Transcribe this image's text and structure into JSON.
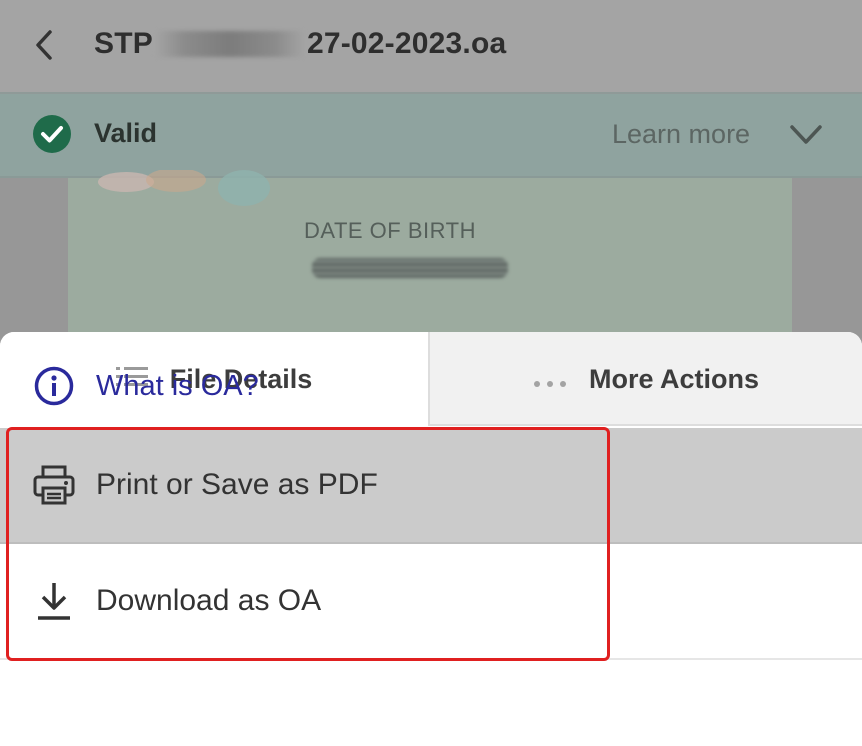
{
  "header": {
    "title_prefix": "STP",
    "title_suffix": "27-02-2023.oa",
    "back_icon": "chevron-left-icon"
  },
  "status": {
    "label": "Valid",
    "learn_more": "Learn more",
    "icon": "check-circle-icon",
    "color": "#1f6b4a"
  },
  "certificate": {
    "field_label": "DATE OF BIRTH"
  },
  "sheet": {
    "tabs": [
      {
        "label": "File Details",
        "icon": "list-icon"
      },
      {
        "label": "More Actions",
        "icon": "more-horizontal-icon"
      }
    ],
    "actions": [
      {
        "label": "Print or Save as PDF",
        "icon": "printer-icon"
      },
      {
        "label": "Download as OA",
        "icon": "download-icon"
      }
    ],
    "help_link": {
      "label": "What is OA?",
      "icon": "info-icon",
      "color": "#2a2a9c"
    }
  },
  "highlight_color": "#e02020"
}
